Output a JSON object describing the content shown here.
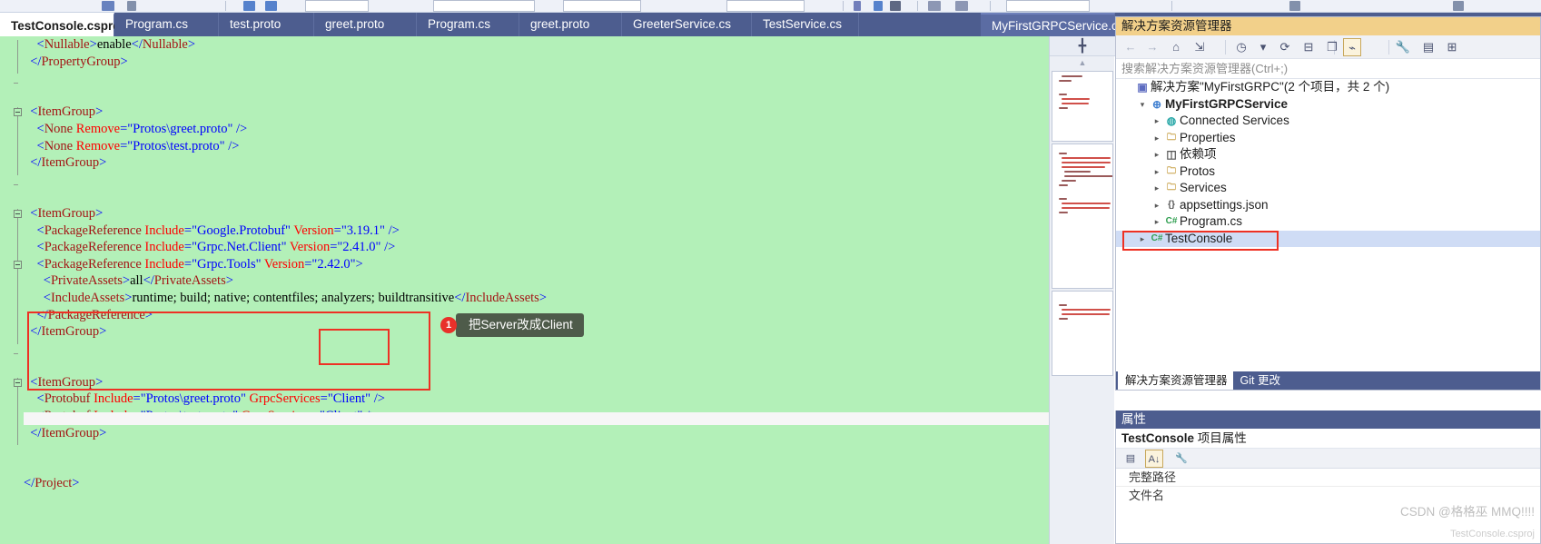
{
  "window": {
    "editor_background": "#b3f0b8",
    "tabbar_background": "#4d5d8f",
    "accent": "#ee3124"
  },
  "tabs": [
    {
      "label": "TestConsole.csproj",
      "active": true,
      "side": "left",
      "pin": "pin-icon",
      "close": "close-icon"
    },
    {
      "label": "Program.cs",
      "active": false,
      "side": "left"
    },
    {
      "label": "test.proto",
      "active": false,
      "side": "left"
    },
    {
      "label": "greet.proto",
      "active": false,
      "side": "left"
    },
    {
      "label": "Program.cs",
      "active": false,
      "side": "left"
    },
    {
      "label": "greet.proto",
      "active": false,
      "side": "left"
    },
    {
      "label": "GreeterService.cs",
      "active": false,
      "side": "left"
    },
    {
      "label": "TestService.cs",
      "active": false,
      "side": "left"
    },
    {
      "label": "MyFirstGRPCService.csproj",
      "active": true,
      "side": "right",
      "pin": "pin-icon",
      "close": "close-icon",
      "menu": "chevron-down-icon",
      "gear": "gear-icon"
    }
  ],
  "editor": {
    "language": "xml",
    "lines": [
      {
        "indent": 2,
        "tokens": [
          {
            "t": "<",
            "c": "br"
          },
          {
            "t": "Nullable",
            "c": "tag"
          },
          {
            "t": ">",
            "c": "br"
          },
          {
            "t": "enable",
            "c": "txt"
          },
          {
            "t": "</",
            "c": "br"
          },
          {
            "t": "Nullable",
            "c": "tag"
          },
          {
            "t": ">",
            "c": "br"
          }
        ]
      },
      {
        "indent": 1,
        "tokens": [
          {
            "t": "</",
            "c": "br"
          },
          {
            "t": "PropertyGroup",
            "c": "tag"
          },
          {
            "t": ">",
            "c": "br"
          }
        ]
      },
      {
        "indent": 0,
        "tokens": []
      },
      {
        "indent": 0,
        "tokens": []
      },
      {
        "indent": 1,
        "tokens": [
          {
            "t": "<",
            "c": "br"
          },
          {
            "t": "ItemGroup",
            "c": "tag"
          },
          {
            "t": ">",
            "c": "br"
          }
        ]
      },
      {
        "indent": 2,
        "tokens": [
          {
            "t": "<",
            "c": "br"
          },
          {
            "t": "None",
            "c": "tag"
          },
          {
            "t": " ",
            "c": "txt"
          },
          {
            "t": "Remove",
            "c": "attr"
          },
          {
            "t": "=",
            "c": "br"
          },
          {
            "t": "\"Protos\\greet.proto\"",
            "c": "val"
          },
          {
            "t": " ",
            "c": "txt"
          },
          {
            "t": "/>",
            "c": "br"
          }
        ]
      },
      {
        "indent": 2,
        "tokens": [
          {
            "t": "<",
            "c": "br"
          },
          {
            "t": "None",
            "c": "tag"
          },
          {
            "t": " ",
            "c": "txt"
          },
          {
            "t": "Remove",
            "c": "attr"
          },
          {
            "t": "=",
            "c": "br"
          },
          {
            "t": "\"Protos\\test.proto\"",
            "c": "val"
          },
          {
            "t": " ",
            "c": "txt"
          },
          {
            "t": "/>",
            "c": "br"
          }
        ]
      },
      {
        "indent": 1,
        "tokens": [
          {
            "t": "</",
            "c": "br"
          },
          {
            "t": "ItemGroup",
            "c": "tag"
          },
          {
            "t": ">",
            "c": "br"
          }
        ]
      },
      {
        "indent": 0,
        "tokens": []
      },
      {
        "indent": 0,
        "tokens": []
      },
      {
        "indent": 1,
        "tokens": [
          {
            "t": "<",
            "c": "br"
          },
          {
            "t": "ItemGroup",
            "c": "tag"
          },
          {
            "t": ">",
            "c": "br"
          }
        ]
      },
      {
        "indent": 2,
        "tokens": [
          {
            "t": "<",
            "c": "br"
          },
          {
            "t": "PackageReference",
            "c": "tag"
          },
          {
            "t": " ",
            "c": "txt"
          },
          {
            "t": "Include",
            "c": "attr"
          },
          {
            "t": "=",
            "c": "br"
          },
          {
            "t": "\"Google.Protobuf\"",
            "c": "val"
          },
          {
            "t": " ",
            "c": "txt"
          },
          {
            "t": "Version",
            "c": "attr"
          },
          {
            "t": "=",
            "c": "br"
          },
          {
            "t": "\"3.19.1\"",
            "c": "val"
          },
          {
            "t": " ",
            "c": "txt"
          },
          {
            "t": "/>",
            "c": "br"
          }
        ]
      },
      {
        "indent": 2,
        "tokens": [
          {
            "t": "<",
            "c": "br"
          },
          {
            "t": "PackageReference",
            "c": "tag"
          },
          {
            "t": " ",
            "c": "txt"
          },
          {
            "t": "Include",
            "c": "attr"
          },
          {
            "t": "=",
            "c": "br"
          },
          {
            "t": "\"Grpc.Net.Client\"",
            "c": "val"
          },
          {
            "t": " ",
            "c": "txt"
          },
          {
            "t": "Version",
            "c": "attr"
          },
          {
            "t": "=",
            "c": "br"
          },
          {
            "t": "\"2.41.0\"",
            "c": "val"
          },
          {
            "t": " ",
            "c": "txt"
          },
          {
            "t": "/>",
            "c": "br"
          }
        ]
      },
      {
        "indent": 2,
        "tokens": [
          {
            "t": "<",
            "c": "br"
          },
          {
            "t": "PackageReference",
            "c": "tag"
          },
          {
            "t": " ",
            "c": "txt"
          },
          {
            "t": "Include",
            "c": "attr"
          },
          {
            "t": "=",
            "c": "br"
          },
          {
            "t": "\"Grpc.Tools\"",
            "c": "val"
          },
          {
            "t": " ",
            "c": "txt"
          },
          {
            "t": "Version",
            "c": "attr"
          },
          {
            "t": "=",
            "c": "br"
          },
          {
            "t": "\"2.42.0\"",
            "c": "val"
          },
          {
            "t": ">",
            "c": "br"
          }
        ]
      },
      {
        "indent": 3,
        "tokens": [
          {
            "t": "<",
            "c": "br"
          },
          {
            "t": "PrivateAssets",
            "c": "tag"
          },
          {
            "t": ">",
            "c": "br"
          },
          {
            "t": "all",
            "c": "txt"
          },
          {
            "t": "</",
            "c": "br"
          },
          {
            "t": "PrivateAssets",
            "c": "tag"
          },
          {
            "t": ">",
            "c": "br"
          }
        ]
      },
      {
        "indent": 3,
        "tokens": [
          {
            "t": "<",
            "c": "br"
          },
          {
            "t": "IncludeAssets",
            "c": "tag"
          },
          {
            "t": ">",
            "c": "br"
          },
          {
            "t": "runtime; build; native; contentfiles; analyzers; buildtransitive",
            "c": "txt"
          },
          {
            "t": "</",
            "c": "br"
          },
          {
            "t": "IncludeAssets",
            "c": "tag"
          },
          {
            "t": ">",
            "c": "br"
          }
        ]
      },
      {
        "indent": 2,
        "tokens": [
          {
            "t": "</",
            "c": "br"
          },
          {
            "t": "PackageReference",
            "c": "tag"
          },
          {
            "t": ">",
            "c": "br"
          }
        ]
      },
      {
        "indent": 1,
        "tokens": [
          {
            "t": "</",
            "c": "br"
          },
          {
            "t": "ItemGroup",
            "c": "tag"
          },
          {
            "t": ">",
            "c": "br"
          }
        ]
      },
      {
        "indent": 0,
        "tokens": []
      },
      {
        "indent": 0,
        "tokens": []
      },
      {
        "indent": 1,
        "tokens": [
          {
            "t": "<",
            "c": "br"
          },
          {
            "t": "ItemGroup",
            "c": "tag"
          },
          {
            "t": ">",
            "c": "br"
          }
        ]
      },
      {
        "indent": 2,
        "tokens": [
          {
            "t": "<",
            "c": "br"
          },
          {
            "t": "Protobuf",
            "c": "tag"
          },
          {
            "t": " ",
            "c": "txt"
          },
          {
            "t": "Include",
            "c": "attr"
          },
          {
            "t": "=",
            "c": "br"
          },
          {
            "t": "\"Protos\\greet.proto\"",
            "c": "val"
          },
          {
            "t": " ",
            "c": "txt"
          },
          {
            "t": "GrpcServices",
            "c": "attr"
          },
          {
            "t": "=",
            "c": "br"
          },
          {
            "t": "\"Client\"",
            "c": "val"
          },
          {
            "t": " ",
            "c": "txt"
          },
          {
            "t": "/>",
            "c": "br"
          }
        ]
      },
      {
        "indent": 2,
        "tokens": [
          {
            "t": "<",
            "c": "br"
          },
          {
            "t": "Protobuf",
            "c": "tag"
          },
          {
            "t": " ",
            "c": "txt"
          },
          {
            "t": "Include",
            "c": "attr"
          },
          {
            "t": "=",
            "c": "br"
          },
          {
            "t": "\"Protos\\test.proto\"",
            "c": "val"
          },
          {
            "t": " ",
            "c": "txt"
          },
          {
            "t": "GrpcServices",
            "c": "attr"
          },
          {
            "t": "=",
            "c": "br"
          },
          {
            "t": "\"Client\"",
            "c": "val"
          },
          {
            "t": " ",
            "c": "txt"
          },
          {
            "t": "/>",
            "c": "br"
          }
        ]
      },
      {
        "indent": 1,
        "tokens": [
          {
            "t": "</",
            "c": "br"
          },
          {
            "t": "ItemGroup",
            "c": "tag"
          },
          {
            "t": ">",
            "c": "br"
          }
        ]
      },
      {
        "indent": 0,
        "tokens": []
      },
      {
        "indent": 0,
        "tokens": []
      },
      {
        "indent": 0,
        "tokens": [
          {
            "t": "</",
            "c": "br"
          },
          {
            "t": "Project",
            "c": "tag"
          },
          {
            "t": ">",
            "c": "br"
          }
        ]
      }
    ]
  },
  "annotation": {
    "badge": "1",
    "text": "把Server改成Client"
  },
  "solution_explorer": {
    "title": "解决方案资源管理器",
    "search_placeholder": "搜索解决方案资源管理器(Ctrl+;)",
    "toolbar": [
      {
        "name": "back-icon",
        "glyph": "←",
        "dim": true
      },
      {
        "name": "forward-icon",
        "glyph": "→",
        "dim": true
      },
      {
        "name": "home-icon",
        "glyph": "⌂",
        "dim": false
      },
      {
        "name": "sync-with-editor-icon",
        "glyph": "⇲",
        "dim": false
      },
      {
        "name": "pending-changes-icon",
        "glyph": "◷",
        "dim": false
      },
      {
        "name": "dropdown-icon",
        "glyph": "▾",
        "dim": false
      },
      {
        "name": "refresh-icon",
        "glyph": "⟳",
        "dim": false
      },
      {
        "name": "collapse-all-icon",
        "glyph": "⊟",
        "dim": false
      },
      {
        "name": "show-all-files-icon",
        "glyph": "❐",
        "dim": false
      },
      {
        "name": "properties-icon",
        "glyph": "⌁",
        "boxed": true
      },
      {
        "name": "wrench-icon",
        "glyph": "🔧",
        "dim": false
      },
      {
        "name": "preview-icon",
        "glyph": "▤",
        "dim": false
      },
      {
        "name": "class-view-icon",
        "glyph": "⊞",
        "dim": false
      }
    ],
    "tree": [
      {
        "label": "解决方案\"MyFirstGRPC\"(2 个项目，共 2 个)",
        "depth": 0,
        "icon": "solution-icon",
        "icon_glyph": "▣",
        "icon_color": "#5c6bc0",
        "expander": "",
        "bold": false,
        "selected": false
      },
      {
        "label": "MyFirstGRPCService",
        "depth": 1,
        "icon": "project-web-icon",
        "icon_glyph": "⊕",
        "icon_color": "#3f7fd0",
        "expander": "▾",
        "bold": true,
        "selected": false
      },
      {
        "label": "Connected Services",
        "depth": 2,
        "icon": "connected-services-icon",
        "icon_glyph": "◍",
        "icon_color": "#2aa8a8",
        "expander": "▸",
        "bold": false,
        "selected": false
      },
      {
        "label": "Properties",
        "depth": 2,
        "icon": "properties-folder-icon",
        "icon_glyph": "🗀",
        "icon_color": "#c8a24a",
        "expander": "▸",
        "bold": false,
        "selected": false
      },
      {
        "label": "依赖项",
        "depth": 2,
        "icon": "dependencies-icon",
        "icon_glyph": "◫",
        "icon_color": "#555555",
        "expander": "▸",
        "bold": false,
        "selected": false
      },
      {
        "label": "Protos",
        "depth": 2,
        "icon": "folder-icon",
        "icon_glyph": "🗀",
        "icon_color": "#c8a24a",
        "expander": "▸",
        "bold": false,
        "selected": false
      },
      {
        "label": "Services",
        "depth": 2,
        "icon": "folder-icon",
        "icon_glyph": "🗀",
        "icon_color": "#c8a24a",
        "expander": "▸",
        "bold": false,
        "selected": false
      },
      {
        "label": "appsettings.json",
        "depth": 2,
        "icon": "json-file-icon",
        "icon_glyph": "{}",
        "icon_color": "#555555",
        "expander": "▸",
        "bold": false,
        "selected": false
      },
      {
        "label": "Program.cs",
        "depth": 2,
        "icon": "csharp-file-icon",
        "icon_glyph": "C#",
        "icon_color": "#2e9e4f",
        "expander": "▸",
        "bold": false,
        "selected": false
      },
      {
        "label": "TestConsole",
        "depth": 1,
        "icon": "csharp-project-icon",
        "icon_glyph": "C#",
        "icon_color": "#2e9e4f",
        "expander": "▸",
        "bold": false,
        "selected": true
      }
    ],
    "bottom_tabs": [
      {
        "label": "解决方案资源管理器",
        "active": true
      },
      {
        "label": "Git 更改",
        "active": false
      }
    ]
  },
  "properties": {
    "title": "属性",
    "object_name": "TestConsole",
    "object_suffix": "项目属性",
    "toolbar": [
      {
        "name": "categorized-icon",
        "glyph": "▤",
        "boxed": false
      },
      {
        "name": "alphabetical-icon",
        "glyph": "A↓",
        "boxed": true
      },
      {
        "name": "property-pages-icon",
        "glyph": "🔧",
        "boxed": false
      }
    ],
    "rows": [
      {
        "label": "完整路径",
        "value": ""
      },
      {
        "label": "文件名",
        "value": ""
      }
    ]
  },
  "watermark": {
    "line1": "CSDN @格格巫 MMQ!!!!",
    "line2": "TestConsole.csproj"
  }
}
